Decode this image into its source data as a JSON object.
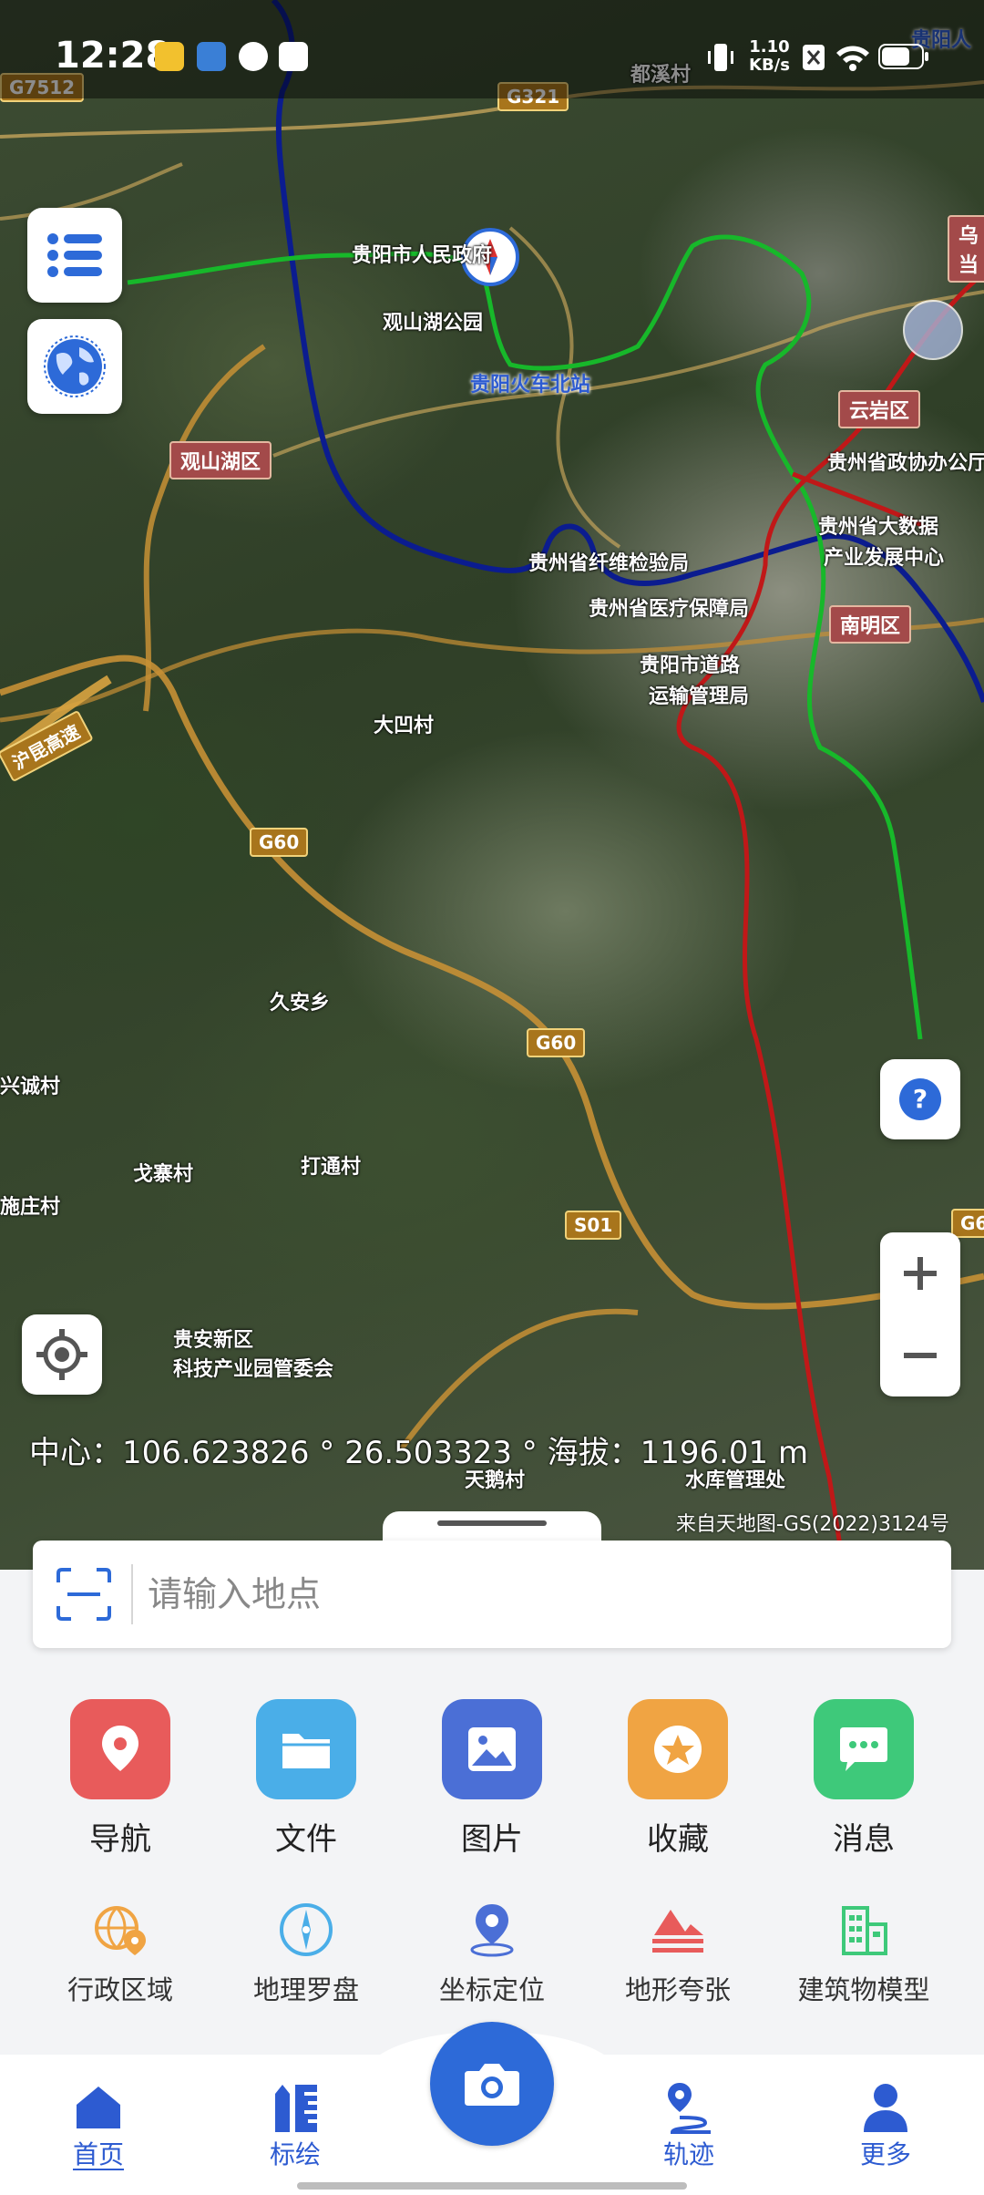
{
  "status_bar": {
    "time": "12:28",
    "net_speed_value": "1.10",
    "net_speed_unit": "KB/s",
    "battery_icon": "battery-icon",
    "wifi_icon": "wifi-icon"
  },
  "map": {
    "labels": [
      "贵阳市人民政府",
      "观山湖公园",
      "贵阳火车北站",
      "贵州省纤维检验局",
      "贵州省医疗保障局",
      "贵阳市道路",
      "运输管理局",
      "贵州省政协办公厅",
      "贵州省大数据",
      "产业发展中心",
      "大凹村",
      "久安乡",
      "戈寨村",
      "打通村",
      "兴诚村",
      "施庄村",
      "贵安新区",
      "科技产业园管委会",
      "天鹅村",
      "水库管理处",
      "都溪村",
      "贵阳人",
      "乌当"
    ],
    "districts": [
      "观山湖区",
      "云岩区",
      "南明区"
    ],
    "road_tags": [
      "G60",
      "G60",
      "S01",
      "G7512",
      "G321",
      "G6"
    ],
    "highway_label": "沪昆高速",
    "brand_accent": "#2d6ad8"
  },
  "controls": {
    "layers_button_icon": "list-icon",
    "basemap_button_icon": "globe-icon",
    "help_button_icon": "question-icon",
    "zoom_in_icon": "plus-icon",
    "zoom_out_icon": "minus-icon",
    "locate_button_icon": "crosshair-icon"
  },
  "coordinates": {
    "text": "中心：106.623826 ° 26.503323 ° 海拔：1196.01 m"
  },
  "attribution": "来自天地图-GS(2022)3124号",
  "search": {
    "placeholder": "请输入地点"
  },
  "quick_actions": [
    {
      "label": "导航",
      "color": "#e85b5b",
      "icon": "navigation-pin-icon"
    },
    {
      "label": "文件",
      "color": "#4aaee8",
      "icon": "folder-icon"
    },
    {
      "label": "图片",
      "color": "#4b6fd6",
      "icon": "image-icon"
    },
    {
      "label": "收藏",
      "color": "#f0a443",
      "icon": "star-icon"
    },
    {
      "label": "消息",
      "color": "#3ec97a",
      "icon": "message-icon"
    }
  ],
  "tools": [
    {
      "label": "行政区域",
      "icon": "globe-pin-icon"
    },
    {
      "label": "地理罗盘",
      "icon": "compass-icon"
    },
    {
      "label": "坐标定位",
      "icon": "location-pin-icon"
    },
    {
      "label": "地形夸张",
      "icon": "terrain-icon"
    },
    {
      "label": "建筑物模型",
      "icon": "building-icon"
    }
  ],
  "bottom_nav": [
    {
      "label": "首页",
      "icon": "home-icon",
      "active": true
    },
    {
      "label": "标绘",
      "icon": "ruler-pencil-icon",
      "active": false
    },
    {
      "label": "轨迹",
      "icon": "track-icon",
      "active": false
    },
    {
      "label": "更多",
      "icon": "user-icon",
      "active": false
    }
  ],
  "camera_icon": "camera-icon"
}
